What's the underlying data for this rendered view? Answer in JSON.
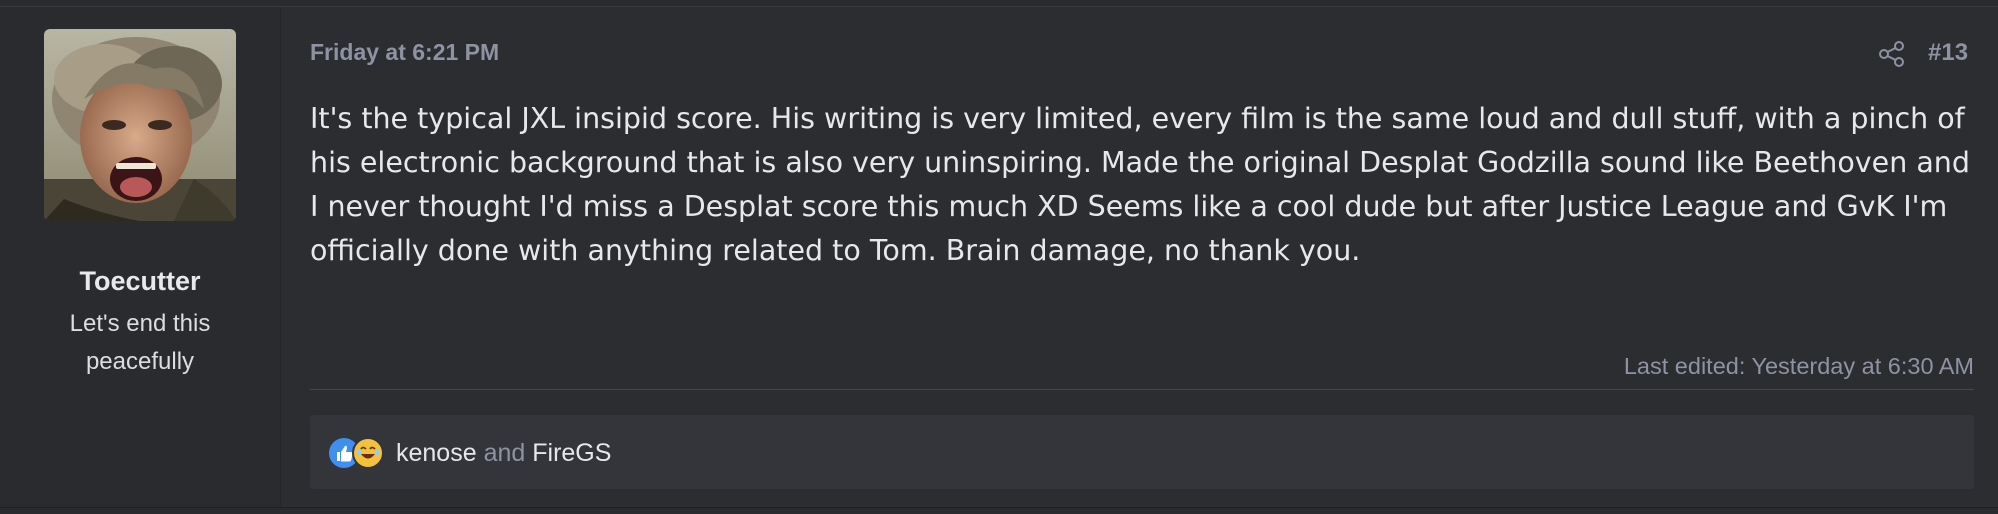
{
  "user": {
    "name": "Toecutter",
    "title": "Let's end this peacefully"
  },
  "post": {
    "date": "Friday at 6:21 PM",
    "number": "#13",
    "body": "It's the typical JXL insipid score. His writing is very limited, every film is the same loud and dull stuff, with a pinch of his electronic background that is also very uninspiring. Made the original Desplat Godzilla sound like Beethoven and I never thought I'd miss a Desplat score this much XD Seems like a cool dude but after Justice League and GvK I'm officially done with anything related to Tom. Brain damage, no thank you.",
    "last_edited": "Last edited: Yesterday at 6:30 AM"
  },
  "reactions": {
    "icons": [
      "like-icon",
      "haha-icon"
    ],
    "user1": "kenose",
    "and": "and",
    "user2": "FireGS"
  },
  "colors": {
    "background": "#2c2d31",
    "muted_text": "#8d93a3",
    "like_blue": "#3f8ef0",
    "haha_yellow": "#f3c13b"
  }
}
